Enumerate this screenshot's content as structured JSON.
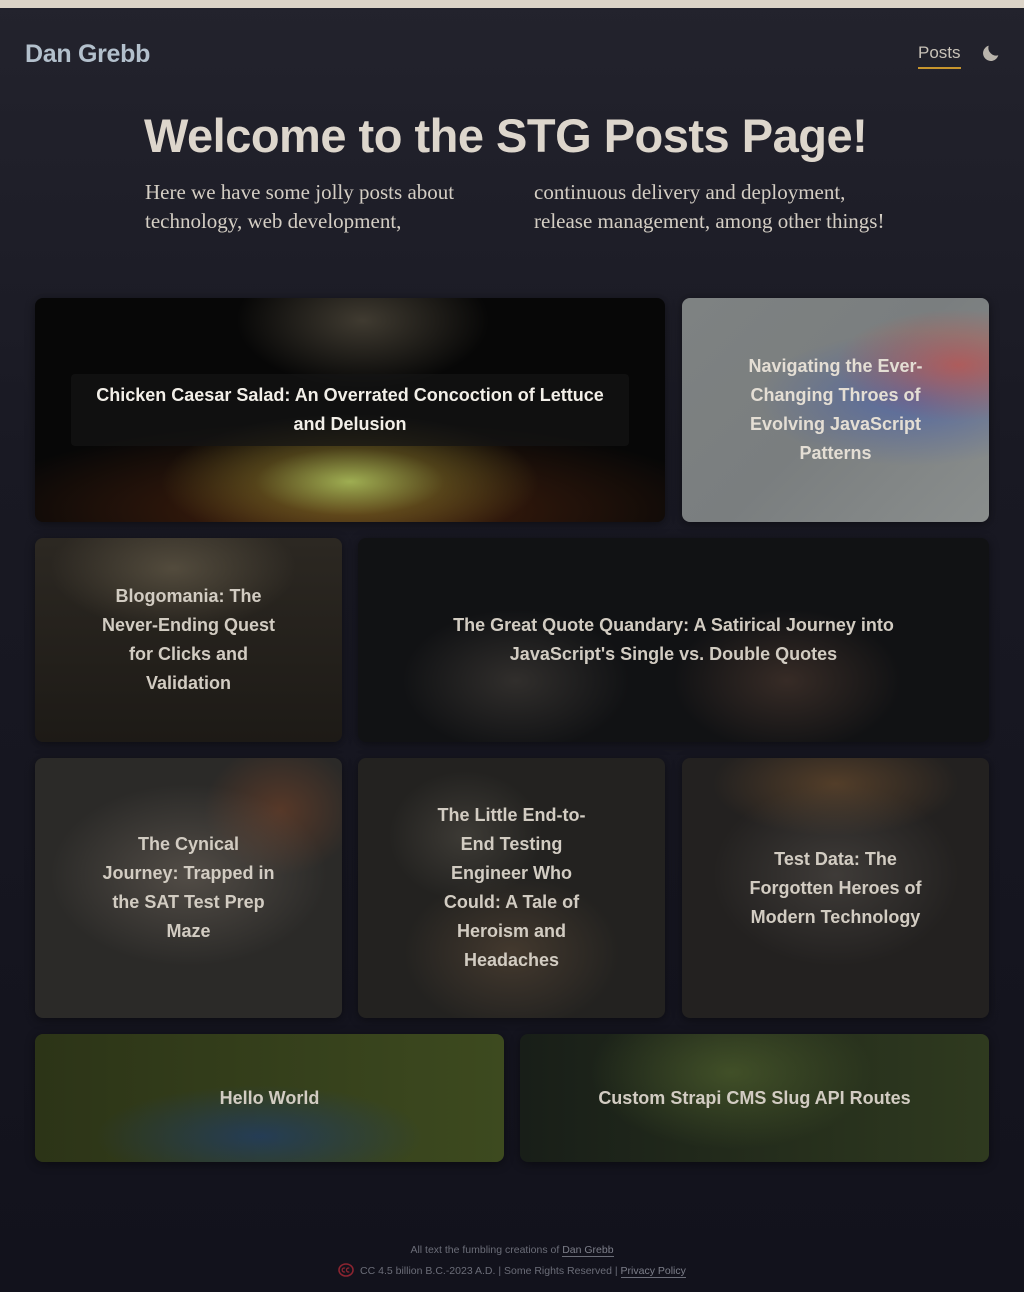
{
  "header": {
    "brand": "Dan Grebb",
    "nav": {
      "posts": "Posts"
    },
    "theme_toggle_icon": "moon-icon"
  },
  "hero": {
    "title": "Welcome to the STG Posts Page!",
    "description": "Here we have some jolly posts about technology, web development, continuous delivery and deployment, release management, among other things!"
  },
  "posts": [
    {
      "title": "Chicken Caesar Salad: An Overrated Concoction of Lettuce and Delusion"
    },
    {
      "title": "Navigating the Ever-Changing Throes of Evolving JavaScript Patterns"
    },
    {
      "title": "Blogomania: The Never-Ending Quest for Clicks and Validation"
    },
    {
      "title": "The Great Quote Quandary: A Satirical Journey into JavaScript's Single vs. Double Quotes"
    },
    {
      "title": "The Cynical Journey: Trapped in the SAT Test Prep Maze"
    },
    {
      "title": "The Little End-to-End Testing Engineer Who Could: A Tale of Heroism and Headaches"
    },
    {
      "title": "Test Data: The Forgotten Heroes of Modern Technology"
    },
    {
      "title": "Hello World"
    },
    {
      "title": "Custom Strapi CMS Slug API Routes"
    }
  ],
  "footer": {
    "line1_prefix": "All text the fumbling creations of",
    "author_link": "Dan Grebb",
    "license_icon": "creative-commons-icon",
    "line2": "CC 4.5 billion B.C.-2023 A.D. | Some Rights Reserved |",
    "privacy_link": "Privacy Policy"
  },
  "colors": {
    "accent_underline": "#c7952d",
    "brand": "#b3c0cc",
    "background": "#191923"
  }
}
